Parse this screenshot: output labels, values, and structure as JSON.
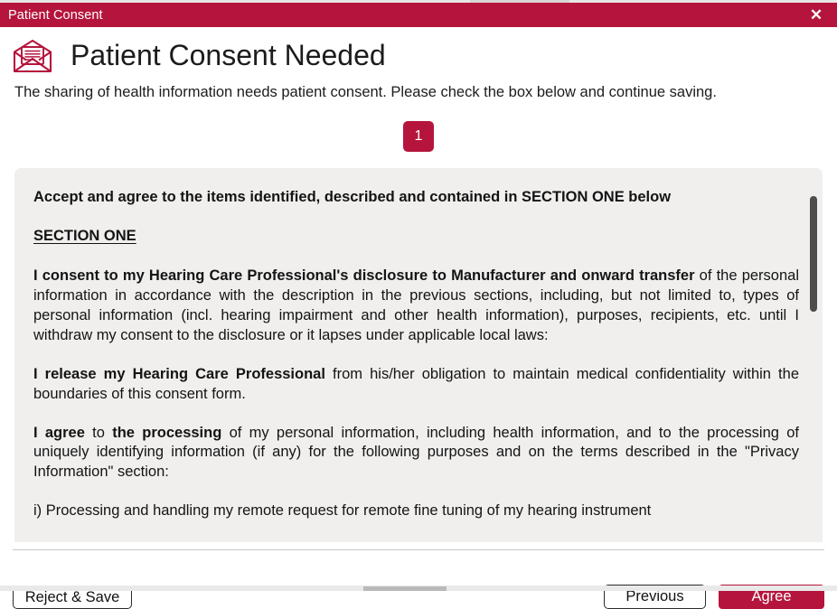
{
  "window": {
    "title": "Patient Consent",
    "close_label": "✕",
    "accent_color": "#b5153c",
    "panel_bg": "#f0efee"
  },
  "header": {
    "icon": "open-envelope-letter-icon",
    "title": "Patient Consent Needed",
    "subtitle": "The sharing of health information needs patient consent. Please check the box below and continue saving."
  },
  "stepper": {
    "current_step": "1"
  },
  "consent": {
    "heading": "Accept and agree to the items identified, described and contained in SECTION ONE below",
    "section_label": "SECTION ONE",
    "paragraphs": [
      {
        "bold_lead": "I consent to my Hearing Care Professional's disclosure to Manufacturer and onward transfer",
        "rest": " of the personal information in accordance with the description in the previous sections, including, but not limited to, types of personal information (incl. hearing impairment and other health information), purposes, recipients, etc. until I withdraw my consent to the disclosure or it lapses under applicable local laws:"
      },
      {
        "bold_lead": "I release my Hearing Care Professional",
        "rest": " from his/her obligation to maintain medical confidentiality within the boundaries of this consent form."
      },
      {
        "bold_lead": "I agree",
        "mid": " to ",
        "bold_second": "the processing",
        "rest": " of my personal information, including health information, and to the processing of uniquely identifying information (if any) for the following purposes and on the terms described in the \"Privacy Information\" section:"
      }
    ],
    "list_item": "i) Processing and handling my remote request for remote fine tuning of my hearing instrument"
  },
  "scrollbar": {
    "name": "vertical-scrollbar"
  },
  "footer": {
    "reject_label": "Reject & Save",
    "previous_label": "Previous",
    "agree_label": "Agree"
  }
}
